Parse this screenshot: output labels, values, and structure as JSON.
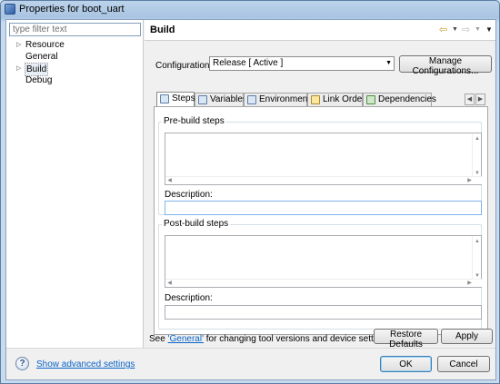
{
  "window": {
    "title": "Properties for boot_uart"
  },
  "sidebar": {
    "filter_placeholder": "type filter text",
    "items": [
      {
        "label": "Resource",
        "expandable": true,
        "selected": false
      },
      {
        "label": "General",
        "expandable": false,
        "selected": false
      },
      {
        "label": "Build",
        "expandable": true,
        "selected": true
      },
      {
        "label": "Debug",
        "expandable": false,
        "selected": false
      }
    ]
  },
  "page": {
    "title": "Build",
    "nav_back_icon": "back-arrow-icon",
    "nav_forward_icon": "forward-arrow-icon",
    "nav_menu_icon": "view-menu-icon"
  },
  "configuration": {
    "label": "Configuration:",
    "selected": "Release  [ Active ]",
    "manage_button": "Manage Configurations..."
  },
  "tabs": [
    {
      "label": "Steps",
      "icon": "steps-icon",
      "active": true
    },
    {
      "label": "Variables",
      "icon": "variables-icon",
      "active": false
    },
    {
      "label": "Environment",
      "icon": "environment-icon",
      "active": false
    },
    {
      "label": "Link Order",
      "icon": "link-order-icon",
      "active": false
    },
    {
      "label": "Dependencies",
      "icon": "dependencies-icon",
      "active": false
    }
  ],
  "steps": {
    "pre_build": {
      "title": "Pre-build steps",
      "commands": "",
      "description_label": "Description:",
      "description": ""
    },
    "post_build": {
      "title": "Post-build steps",
      "commands": "",
      "description_label": "Description:",
      "description": ""
    }
  },
  "footer": {
    "see_prefix": "See ",
    "see_link": "'General'",
    "see_suffix": " for changing tool versions and device settings",
    "restore_defaults": "Restore Defaults",
    "apply": "Apply",
    "show_advanced": "Show advanced settings",
    "ok": "OK",
    "cancel": "Cancel"
  },
  "colors": {
    "link": "#0a64c8",
    "nav_arrow": "#c89a28"
  }
}
